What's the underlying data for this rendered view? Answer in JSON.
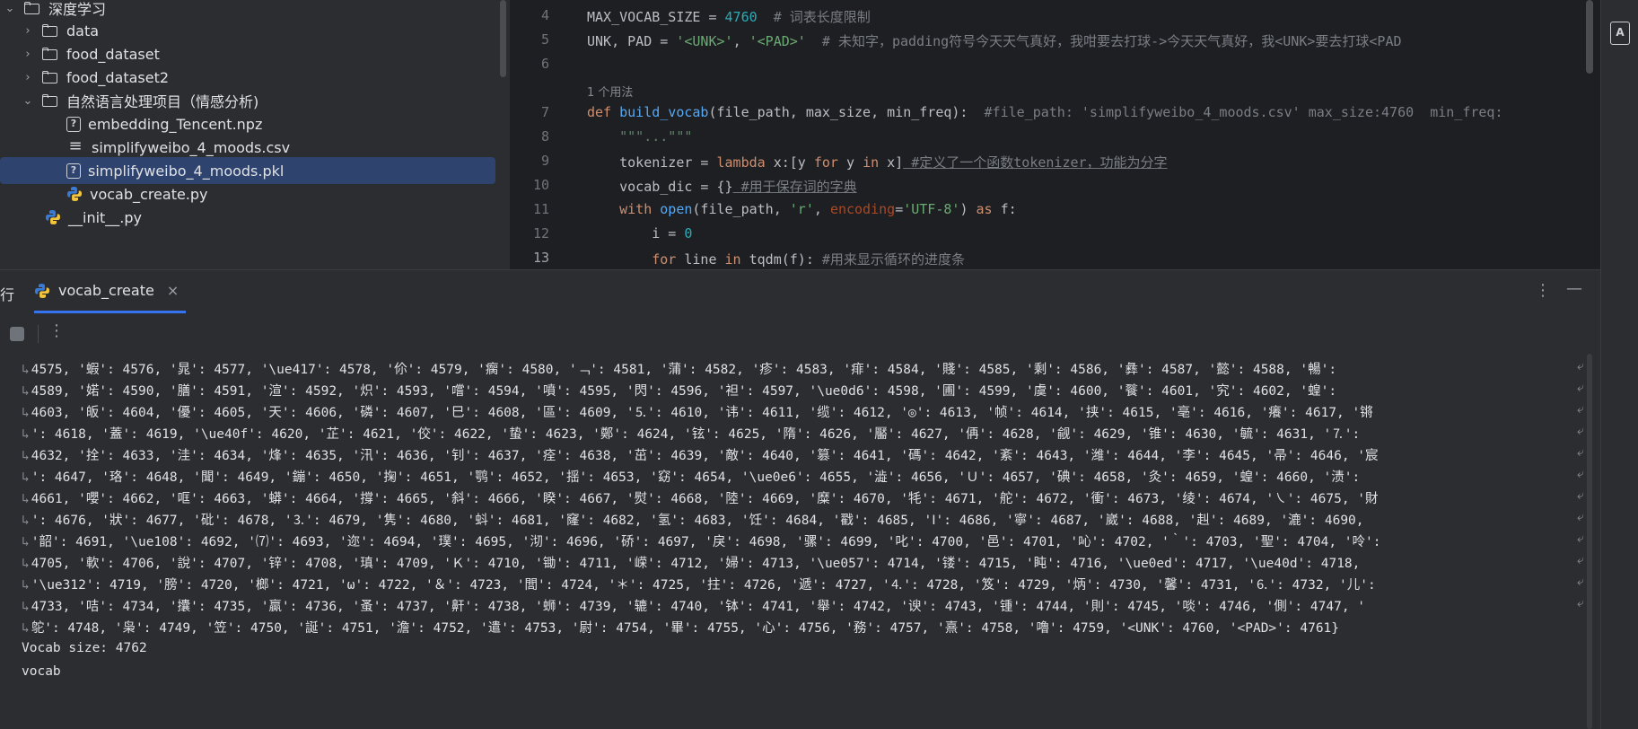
{
  "project_tree": {
    "items": [
      {
        "label": "深度学习",
        "type": "folder",
        "expanded": true,
        "depth": 0
      },
      {
        "label": "data",
        "type": "folder",
        "expanded": false,
        "depth": 1
      },
      {
        "label": "food_dataset",
        "type": "folder",
        "expanded": false,
        "depth": 1
      },
      {
        "label": "food_dataset2",
        "type": "folder",
        "expanded": false,
        "depth": 1
      },
      {
        "label": "自然语言处理项目（情感分析)",
        "type": "folder",
        "expanded": true,
        "depth": 1
      },
      {
        "label": "embedding_Tencent.npz",
        "type": "unknown-file",
        "depth": 2
      },
      {
        "label": "simplifyweibo_4_moods.csv",
        "type": "text-file",
        "depth": 2
      },
      {
        "label": "simplifyweibo_4_moods.pkl",
        "type": "unknown-file",
        "depth": 2,
        "selected": true
      },
      {
        "label": "vocab_create.py",
        "type": "python-file",
        "depth": 2
      },
      {
        "label": "__init__.py",
        "type": "python-file",
        "depth": 1
      }
    ]
  },
  "editor": {
    "line_numbers": [
      "4",
      "5",
      "6",
      "",
      "7",
      "8",
      "9",
      "10",
      "11",
      "12",
      "13"
    ],
    "usage_hint": "1 个用法",
    "lines": {
      "l4_name": "MAX_VOCAB_SIZE",
      "l4_eq": " = ",
      "l4_num": "4760",
      "l4_comment": "  # 词表长度限制",
      "l5_names": "UNK, PAD = ",
      "l5_str1": "'<UNK>'",
      "l5_comma": ", ",
      "l5_str2": "'<PAD>'",
      "l5_comment": "  # 未知字，padding符号今天天气真好，我咁要去打球->今天天气真好，我<UNK>要去打球<PAD",
      "l7_def": "def ",
      "l7_fn": "build_vocab",
      "l7_params": "(file_path, max_size, min_freq):",
      "l7_comment": "  #file_path: 'simplifyweibo_4_moods.csv' max_size:4760  min_freq:",
      "l8_doc": "    \"\"\"...\"\"\"",
      "l9_a": "    tokenizer = ",
      "l9_lambda": "lambda",
      "l9_b": " x:[y ",
      "l9_for": "for",
      "l9_c": " y ",
      "l9_in": "in",
      "l9_d": " x]",
      "l9_comment": " #定义了一个函数tokenizer，功能为分字",
      "l10_a": "    vocab_dic = {}",
      "l10_comment": " #用于保存词的字典",
      "l11_with": "    with ",
      "l11_open": "open",
      "l11_a": "(file_path, ",
      "l11_r": "'r'",
      "l11_b": ", ",
      "l11_enc": "encoding",
      "l11_c": "=",
      "l11_utf": "'UTF-8'",
      "l11_d": ") ",
      "l11_as": "as",
      "l11_e": " f:",
      "l12_a": "        i = ",
      "l12_num": "0",
      "l13_for": "        for",
      "l13_a": " line ",
      "l13_in": "in",
      "l13_b": " tqdm(f): ",
      "l13_comment": "#用来显示循环的进度条"
    }
  },
  "run_panel": {
    "cut_label": "行",
    "tab_label": "vocab_create",
    "menu_glyph": "⋮",
    "minimize_glyph": "—"
  },
  "console": {
    "lines": [
      "4575, '蝦': 4576, '晁': 4577, '\\ue417': 4578, '伱': 4579, '瘸': 4580, '﹁': 4581, '蒲': 4582, '疹': 4583, '痱': 4584, '賤': 4585, '剩': 4586, '彝': 4587, '懿': 4588, '暢':",
      "4589, '婼': 4590, '膳': 4591, '渲': 4592, '炽': 4593, '嚐': 4594, '噴': 4595, '閃': 4596, '袒': 4597, '\\ue0d6': 4598, '圃': 4599, '虞': 4600, '餮': 4601, '究': 4602, '蝗':",
      "4603, '皈': 4604, '優': 4605, '天': 4606, '磷': 4607, '巳': 4608, '區': 4609, '⒌': 4610, '讳': 4611, '缆': 4612, '◎': 4613, '帧': 4614, '挟': 4615, '亳': 4616, '癢': 4617, '锵",
      "': 4618, '蓋': 4619, '\\ue40f': 4620, '芷': 4621, '佼': 4622, '蛰': 4623, '鄭': 4624, '铉': 4625, '隋': 4626, '靨': 4627, '侢': 4628, '觎': 4629, '锥': 4630, '毓': 4631, '⒎':",
      "4632, '拴': 4633, '洼': 4634, '烽': 4635, '汛': 4636, '钊': 4637, '痊': 4638, '茁': 4639, '敵': 4640, '篡': 4641, '碼': 4642, '紊': 4643, '潍': 4644, '李': 4645, '帚': 4646, '宸",
      "': 4647, '珞': 4648, '聞': 4649, '鏰': 4650, '掬': 4651, '鹗': 4652, '揺': 4653, '窈': 4654, '\\ue0e6': 4655, '澁': 4656, 'Ｕ': 4657, '碘': 4658, '灸': 4659, '蝗': 4660, '渍':",
      "4661, '嚶': 4662, '哐': 4663, '蟒': 4664, '撐': 4665, '斜': 4666, '睽': 4667, '熨': 4668, '陸': 4669, '糜': 4670, '牦': 4671, '舵': 4672, '衝': 4673, '绫': 4674, '㇏': 4675, '財",
      "': 4676, '狀': 4677, '砒': 4678, '⒊': 4679, '隽': 4680, '蚪': 4681, '窿': 4682, '氢': 4683, '饪': 4684, '戳': 4685, 'Ⅰ': 4686, '寧': 4687, '崴': 4688, '赳': 4689, '漉': 4690,",
      "'韶': 4691, '\\ue108': 4692, '⑺': 4693, '迩': 4694, '璞': 4695, '沏': 4696, '硚': 4697, '戾': 4698, '骡': 4699, '叱': 4700, '邑': 4701, '吣': 4702, '｀': 4703, '聖': 4704, '呤':",
      "4705, '軟': 4706, '說': 4707, '锌': 4708, '瑱': 4709, 'Ｋ': 4710, '锄': 4711, '嵘': 4712, '婦': 4713, '\\ue057': 4714, '镂': 4715, '盹': 4716, '\\ue0ed': 4717, '\\ue40d': 4718,",
      "'\\ue312': 4719, '膀': 4720, '榔': 4721, 'ω': 4722, '＆': 4723, '閭': 4724, '＊': 4725, '拄': 4726, '遞': 4727, '⒋': 4728, '笈': 4729, '炳': 4730, '馨': 4731, '⒍': 4732, '儿':",
      "4733, '咭': 4734, '攮': 4735, '贏': 4736, '蚤': 4737, '鼾': 4738, '蛳': 4739, '辘': 4740, '钵': 4741, '舉': 4742, '谀': 4743, '锺': 4744, '則': 4745, '啖': 4746, '側': 4747, '",
      "鸵': 4748, '枭': 4749, '笠': 4750, '誕': 4751, '澹': 4752, '遣': 4753, '尉': 4754, '畢': 4755, '心': 4756, '務': 4757, '熹': 4758, '嚕': 4759, '<UNK': 4760, '<PAD>': 4761}",
      "Vocab size: 4762",
      "vocab"
    ],
    "wrap_glyph_start": "↳",
    "wrap_glyph_end": "⤶"
  },
  "colors": {
    "background": "#1e1f22",
    "panel": "#2b2d30",
    "selection": "#2e436e",
    "accent": "#3574f0",
    "keyword": "#cf8e6d",
    "string": "#6aab73",
    "number": "#2aacb8",
    "function": "#56a8f5",
    "comment": "#7a7e85"
  },
  "icons": [
    "chevron-down-icon",
    "chevron-right-icon",
    "folder-icon",
    "unknown-file-icon",
    "text-file-icon",
    "python-file-icon",
    "stop-icon",
    "more-icon",
    "minimize-icon",
    "close-icon",
    "ai-assistant-icon"
  ]
}
